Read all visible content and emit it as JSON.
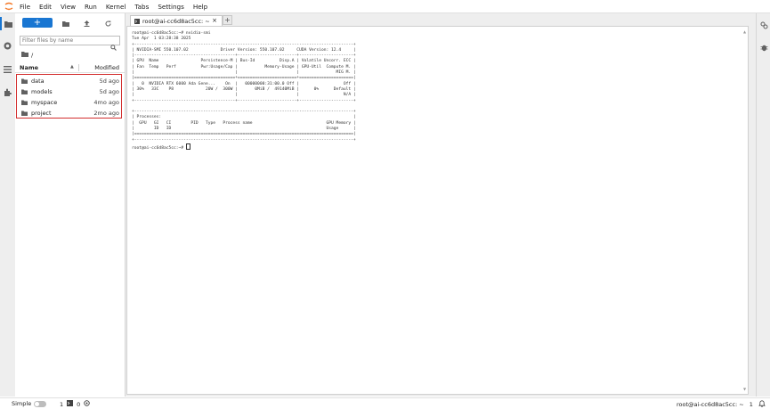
{
  "menu": {
    "items": [
      "File",
      "Edit",
      "View",
      "Run",
      "Kernel",
      "Tabs",
      "Settings",
      "Help"
    ]
  },
  "colors": {
    "accent": "#1976d2",
    "highlight_border": "#d32f2f"
  },
  "activity_bar": {
    "icons": [
      "folder-icon",
      "running-icon",
      "toc-icon",
      "extension-icon"
    ]
  },
  "right_bar": {
    "icons": [
      "property-inspector-icon",
      "debugger-icon"
    ]
  },
  "file_browser": {
    "new_label": "+",
    "search_placeholder": "Filter files by name",
    "breadcrumb": "/",
    "columns": {
      "name": "Name",
      "modified": "Modified"
    },
    "files": [
      {
        "name": "data",
        "modified": "5d ago"
      },
      {
        "name": "models",
        "modified": "5d ago"
      },
      {
        "name": "myspace",
        "modified": "4mo ago"
      },
      {
        "name": "project",
        "modified": "2mo ago"
      }
    ]
  },
  "tabs": [
    {
      "label": "root@ai-cc6d8ac5cc: ~",
      "close": "×"
    }
  ],
  "add_tab_label": "+",
  "terminal": {
    "lines": [
      "root@ai-cc6d8ac5cc:~# nvidia-smi",
      "Tue Apr  1 03:28:38 2025",
      "+-----------------------------------------------------------------------------------------+",
      "| NVIDIA-SMI 550.107.02             Driver Version: 550.107.02     CUDA Version: 12.4     |",
      "|-----------------------------------------+------------------------+----------------------+",
      "| GPU  Name                 Persistence-M | Bus-Id          Disp.A | Volatile Uncorr. ECC |",
      "| Fan  Temp   Perf          Pwr:Usage/Cap |           Memory-Usage | GPU-Util  Compute M. |",
      "|                                         |                        |               MIG M. |",
      "|=========================================+========================+======================|",
      "|   0  NVIDIA RTX 6000 Ada Gene...    On  |   00000000:31:00.0 Off |                  Off |",
      "| 30%   33C    P8             20W /  300W |       0MiB /  49140MiB |      0%      Default |",
      "|                                         |                        |                  N/A |",
      "+-----------------------------------------+------------------------+----------------------+",
      "",
      "+-----------------------------------------------------------------------------------------+",
      "| Processes:                                                                              |",
      "|  GPU   GI   CI        PID   Type   Process name                              GPU Memory |",
      "|        ID   ID                                                               Usage      |",
      "|=========================================================================================|",
      "+-----------------------------------------------------------------------------------------+",
      "root@ai-cc6d8ac5cc:~# "
    ]
  },
  "status": {
    "mode_label": "Simple",
    "kernels_count": "1",
    "terminals_count": "0",
    "right_label": "root@ai-cc6d8ac5cc: ~",
    "right_count": "1"
  }
}
